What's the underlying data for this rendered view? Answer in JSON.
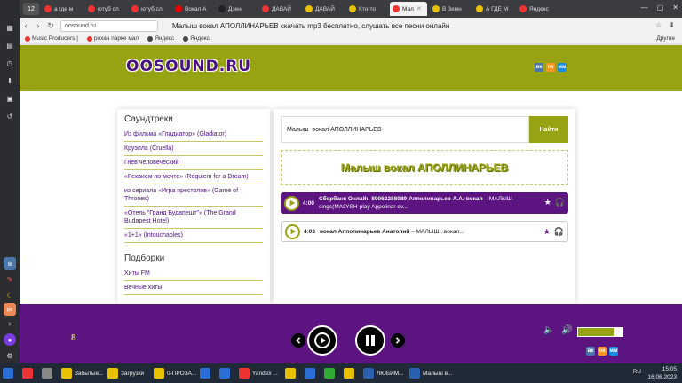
{
  "browser": {
    "tab_count": "12",
    "tabs": [
      {
        "label": "а где м",
        "color": "#e33"
      },
      {
        "label": "ютуб сл",
        "color": "#e33"
      },
      {
        "label": "ютуб сл",
        "color": "#e33"
      },
      {
        "label": "Вокал А",
        "color": "#e00"
      },
      {
        "label": "Дзен",
        "color": "#222"
      },
      {
        "label": "ДАВАЙ",
        "color": "#e33"
      },
      {
        "label": "ДАВАЙ",
        "color": "#e8c200"
      },
      {
        "label": "Кто-то",
        "color": "#e8c200"
      },
      {
        "label": "Мал",
        "color": "#e33",
        "active": true
      },
      {
        "label": "В Земн",
        "color": "#e8c200"
      },
      {
        "label": "А ГДЕ М",
        "color": "#e8c200"
      },
      {
        "label": "Яндекс",
        "color": "#e33"
      }
    ],
    "url": "oosound.ru",
    "page_title": "Малыш вокал АПОЛЛИНАРЬЕВ скачать mp3 бесплатно, слушать все песни онлайн",
    "bookmarks": [
      "Music Producers |",
      "рохан парке мал",
      "Яндекс",
      "Яндекс"
    ],
    "bookmarks_other": "Другое"
  },
  "site": {
    "logo": "OOSOUND.RU",
    "social": [
      "вк",
      "ок",
      "мм"
    ]
  },
  "sidebar": {
    "soundtracks_title": "Саундтреки",
    "soundtracks": [
      "Из фильма «Гладиатор» (Gladiator)",
      "Круэлла (Cruella)",
      "Гнев человеческий",
      "«Реквием по мечте» (Requiem for a Dream)",
      "из сериала «Игра престолов» (Game of Thrones)",
      "«Отель \"Гранд Будапешт\"» (The Grand Budapest Hotel)",
      "«1+1» (Intouchables)"
    ],
    "collections_title": "Подборки",
    "collections": [
      "Хиты FM",
      "Вечные хиты"
    ]
  },
  "search": {
    "value": "Малыш  вокал АПОЛЛИНАРЬЕВ",
    "button": "Найти"
  },
  "heading": "Малыш вокал АПОЛЛИНАРЬЕВ",
  "tracks": [
    {
      "duration": "4:00",
      "artist": "Сбербанк Онлайн 89062288089-Апполинарьев А.А.-вокал",
      "title": " – МАЛЫШ-sings(MALYSH-play Appolinar ev..."
    },
    {
      "duration": "4:03",
      "artist": "вокал Апполинарьев Анатолий",
      "title": " – МАЛЫШ...вокал..."
    }
  ],
  "player": {
    "eight": "8",
    "volume": 0.8
  },
  "taskbar": {
    "items": [
      "",
      "",
      "",
      "Забытые...",
      "Загрузки",
      "0-ПРОЗА...",
      "",
      "",
      "Yandex ...",
      "",
      "",
      "",
      "",
      "ЛЮБИМ...",
      "Малыш в..."
    ],
    "lang": "RU",
    "time": "15:05",
    "date": "16.06.2023"
  }
}
